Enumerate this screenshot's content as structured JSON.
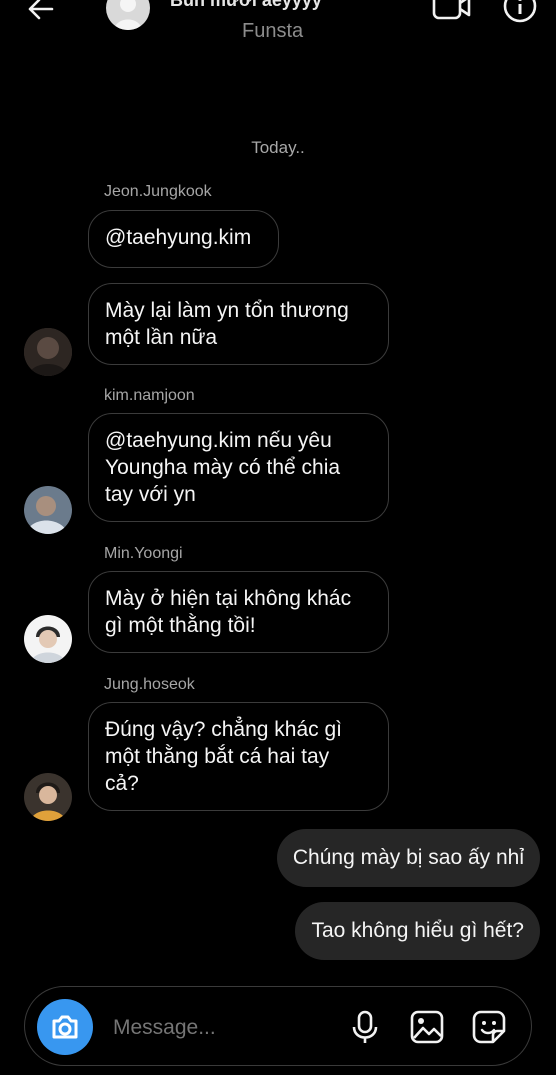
{
  "header": {
    "title": "Bún mười aeyyyy",
    "subtitle": "Funsta"
  },
  "date_label": "Today..",
  "messages": [
    {
      "sender": "Jeon.Jungkook",
      "text": "@taehyung.kim"
    },
    {
      "text_lines": [
        "Mày lại làm yn tổn thương",
        "một lần nữa"
      ]
    },
    {
      "sender": "kim.namjoon",
      "text_lines": [
        "@taehyung.kim nếu yêu",
        "Youngha mày có thể chia",
        "tay với yn"
      ]
    },
    {
      "sender": "Min.Yoongi",
      "text_lines": [
        "Mày ở hiện tại không khác",
        "gì một thằng tồi!"
      ]
    },
    {
      "sender": "Jung.hoseok",
      "text_lines": [
        "Đúng vậy? chẳng khác gì",
        "một thằng bắt cá hai tay",
        "cả?"
      ]
    }
  ],
  "outgoing": [
    {
      "text": "Chúng mày bị sao ấy nhỉ"
    },
    {
      "text": "Tao không hiểu gì hết?"
    }
  ],
  "composer": {
    "placeholder": "Message..."
  },
  "colors": {
    "accent": "#3897f0",
    "outgoing_bubble": "#262626",
    "incoming_border": "#3b3b3b"
  },
  "icons": [
    "back-arrow-icon",
    "video-call-icon",
    "info-icon",
    "camera-icon",
    "microphone-icon",
    "gallery-icon",
    "sticker-icon"
  ]
}
